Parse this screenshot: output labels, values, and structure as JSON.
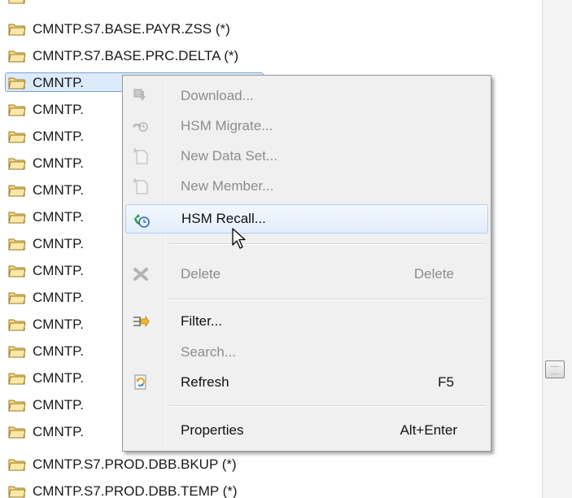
{
  "tree": {
    "items": [
      {
        "label": "CMNTP.S7.BASE.PAYR.ZSS (*)"
      },
      {
        "label": "CMNTP.S7.BASE.PRC.DELTA (*)"
      },
      {
        "label": "CMNTP."
      },
      {
        "label": "CMNTP."
      },
      {
        "label": "CMNTP."
      },
      {
        "label": "CMNTP."
      },
      {
        "label": "CMNTP."
      },
      {
        "label": "CMNTP."
      },
      {
        "label": "CMNTP."
      },
      {
        "label": "CMNTP."
      },
      {
        "label": "CMNTP."
      },
      {
        "label": "CMNTP."
      },
      {
        "label": "CMNTP."
      },
      {
        "label": "CMNTP."
      },
      {
        "label": "CMNTP."
      },
      {
        "label": "CMNTP."
      },
      {
        "label": "CMNTP.S7.PROD.DBB.BKUP (*)"
      },
      {
        "label": "CMNTP.S7.PROD.DBB.TEMP (*)"
      }
    ],
    "selected_index": 2
  },
  "context_menu": {
    "items": [
      {
        "label": "Download...",
        "accelerator": "",
        "enabled": false,
        "icon": "download-icon"
      },
      {
        "label": "HSM Migrate...",
        "accelerator": "",
        "enabled": false,
        "icon": "hsm-migrate-icon"
      },
      {
        "label": "New Data Set...",
        "accelerator": "",
        "enabled": false,
        "icon": "new-dataset-icon"
      },
      {
        "label": "New Member...",
        "accelerator": "",
        "enabled": false,
        "icon": "new-member-icon"
      },
      {
        "label": "HSM Recall...",
        "accelerator": "",
        "enabled": true,
        "icon": "hsm-recall-icon",
        "hover": true
      },
      {
        "label": "Delete",
        "accelerator": "Delete",
        "enabled": false,
        "icon": "delete-icon"
      },
      {
        "label": "Filter...",
        "accelerator": "",
        "enabled": true,
        "icon": "filter-icon"
      },
      {
        "label": "Search...",
        "accelerator": "",
        "enabled": false,
        "icon": ""
      },
      {
        "label": "Refresh",
        "accelerator": "F5",
        "enabled": true,
        "icon": "refresh-icon"
      },
      {
        "label": "Properties",
        "accelerator": "Alt+Enter",
        "enabled": true,
        "icon": ""
      }
    ]
  },
  "colors": {
    "selection_bg": "#dcebfc",
    "menu_bg": "#f0f0f0",
    "disabled_text": "#8d8d8d",
    "folder_fill": "#f7d97c"
  }
}
